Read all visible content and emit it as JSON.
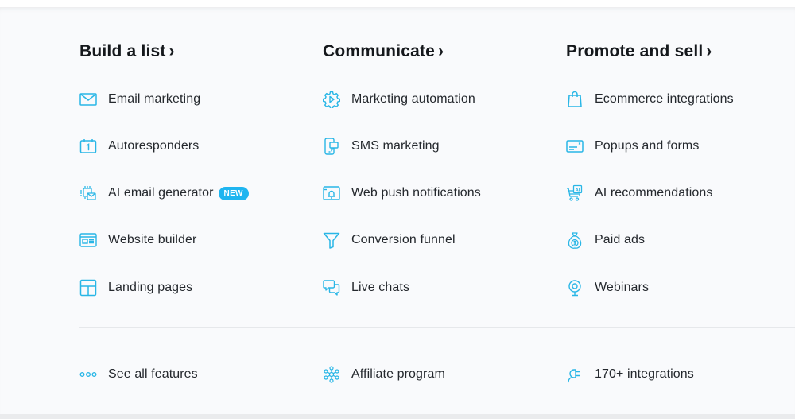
{
  "colors": {
    "accent": "#1fb5f0",
    "icon": "#29b6e6",
    "text": "#24282d",
    "heading": "#15181c",
    "panel_bg": "#f9fafc"
  },
  "columns": [
    {
      "title": "Build a list",
      "chevron": "›",
      "items": [
        {
          "label": "Email marketing",
          "icon": "envelope-icon"
        },
        {
          "label": "Autoresponders",
          "icon": "calendar-icon"
        },
        {
          "label": "AI email generator",
          "icon": "ai-email-icon",
          "badge": "NEW"
        },
        {
          "label": "Website builder",
          "icon": "website-builder-icon"
        },
        {
          "label": "Landing pages",
          "icon": "landing-page-icon"
        }
      ]
    },
    {
      "title": "Communicate",
      "chevron": "›",
      "items": [
        {
          "label": "Marketing automation",
          "icon": "gear-play-icon"
        },
        {
          "label": "SMS marketing",
          "icon": "phone-message-icon"
        },
        {
          "label": "Web push notifications",
          "icon": "browser-bell-icon"
        },
        {
          "label": "Conversion funnel",
          "icon": "funnel-icon"
        },
        {
          "label": "Live chats",
          "icon": "chat-bubbles-icon"
        }
      ]
    },
    {
      "title": "Promote and sell",
      "chevron": "›",
      "items": [
        {
          "label": "Ecommerce integrations",
          "icon": "shopping-bag-icon"
        },
        {
          "label": "Popups and forms",
          "icon": "popup-form-icon"
        },
        {
          "label": "AI recommendations",
          "icon": "ai-cart-icon"
        },
        {
          "label": "Paid ads",
          "icon": "money-bag-icon"
        },
        {
          "label": "Webinars",
          "icon": "webcam-icon"
        }
      ]
    }
  ],
  "footer_links": [
    {
      "label": "See all features",
      "icon": "dots-icon"
    },
    {
      "label": "Affiliate program",
      "icon": "network-icon"
    },
    {
      "label": "170+ integrations",
      "icon": "plug-icon"
    }
  ]
}
